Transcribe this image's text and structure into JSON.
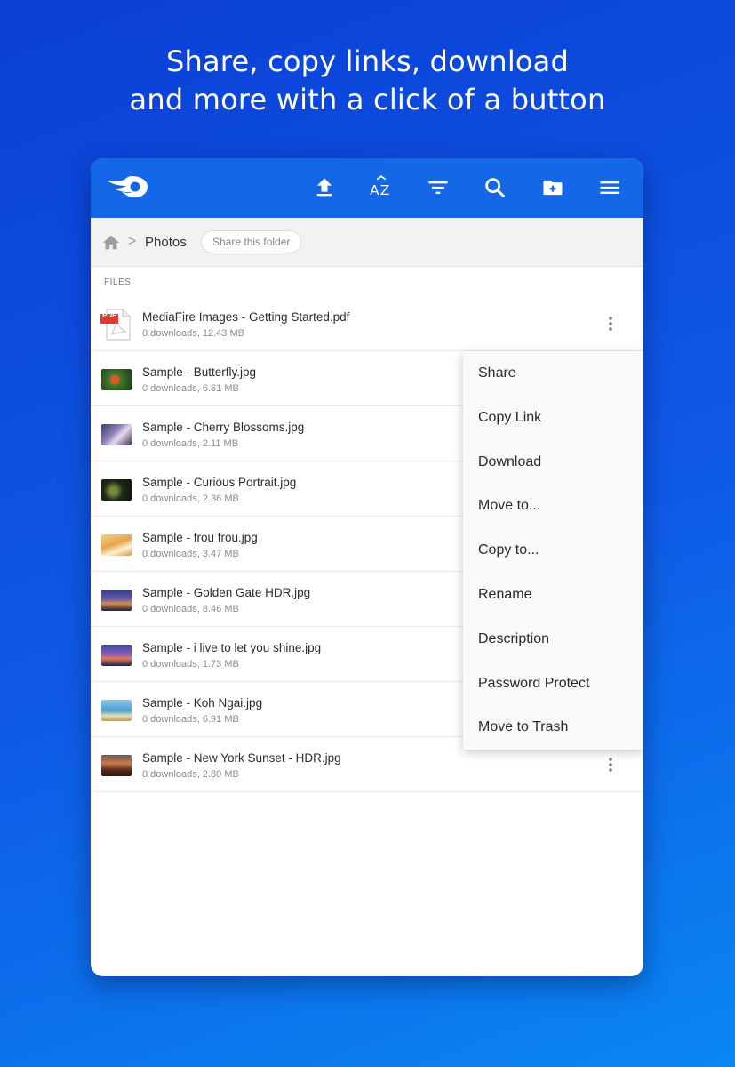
{
  "headline": {
    "line1": "Share, copy links, download",
    "line2": "and more with a click of a button"
  },
  "colors": {
    "brand": "#1468e8",
    "background_top": "#0b3fd6",
    "background_bottom": "#0a86f2"
  },
  "toolbar": {
    "icons": [
      "upload-icon",
      "sort-az-icon",
      "filter-icon",
      "search-icon",
      "new-folder-icon",
      "menu-icon"
    ]
  },
  "breadcrumb": {
    "home_icon": "home-icon",
    "separator": ">",
    "current": "Photos",
    "share_label": "Share this folder"
  },
  "files_label": "FILES",
  "files": [
    {
      "name": "MediaFire Images - Getting Started.pdf",
      "meta": "0 downloads, 12.43 MB",
      "type": "pdf"
    },
    {
      "name": "Sample - Butterfly.jpg",
      "meta": "0 downloads, 6.61 MB",
      "type": "image"
    },
    {
      "name": "Sample - Cherry Blossoms.jpg",
      "meta": "0 downloads, 2.11 MB",
      "type": "image"
    },
    {
      "name": "Sample - Curious Portrait.jpg",
      "meta": "0 downloads, 2.36 MB",
      "type": "image"
    },
    {
      "name": "Sample - frou frou.jpg",
      "meta": "0 downloads, 3.47 MB",
      "type": "image"
    },
    {
      "name": "Sample - Golden Gate HDR.jpg",
      "meta": "0 downloads, 8.46 MB",
      "type": "image"
    },
    {
      "name": "Sample - i live to let you shine.jpg",
      "meta": "0 downloads, 1.73 MB",
      "type": "image"
    },
    {
      "name": "Sample - Koh Ngai.jpg",
      "meta": "0 downloads, 6.91 MB",
      "type": "image"
    },
    {
      "name": "Sample - New York Sunset - HDR.jpg",
      "meta": "0 downloads, 2.80 MB",
      "type": "image"
    }
  ],
  "pdf_badge": "PDF",
  "context_menu": [
    "Share",
    "Copy Link",
    "Download",
    "Move to...",
    "Copy to...",
    "Rename",
    "Description",
    "Password Protect",
    "Move to Trash"
  ]
}
